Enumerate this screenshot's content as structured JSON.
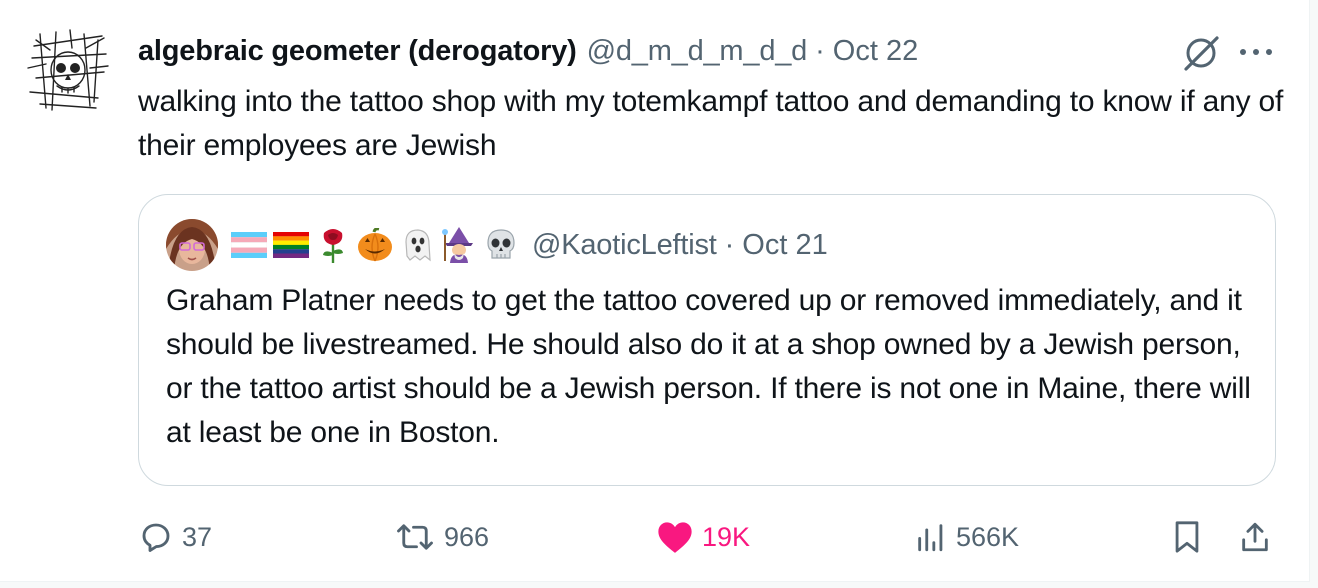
{
  "tweet": {
    "display_name": "algebraic geometer (derogatory)",
    "handle": "@d_m_d_m_d_d",
    "separator": "·",
    "date": "Oct 22",
    "text": "walking into the tattoo shop with my totemkampf tattoo and demanding to know if any of their employees are Jewish",
    "avatar_icon": "skull-sketch-avatar",
    "menu_icons": [
      "grok-icon",
      "more-options-icon"
    ]
  },
  "quote": {
    "avatar_icon": "profile-photo-avatar",
    "name_emojis": [
      "transgender-flag",
      "rainbow-flag",
      "rose",
      "jack-o-lantern",
      "ghost",
      "mage",
      "skull"
    ],
    "handle": "@KaoticLeftist",
    "separator": "·",
    "date": "Oct 21",
    "text": "Graham Platner needs to get the tattoo covered up or removed immediately, and it should be livestreamed. He should also do it at a shop owned by a Jewish person, or the tattoo artist should be a Jewish person. If there is not one in Maine, there will at least be one in Boston."
  },
  "actions": {
    "replies": "37",
    "reposts": "966",
    "likes": "19K",
    "views": "566K",
    "like_color": "#f91880",
    "muted_color": "#536471"
  }
}
